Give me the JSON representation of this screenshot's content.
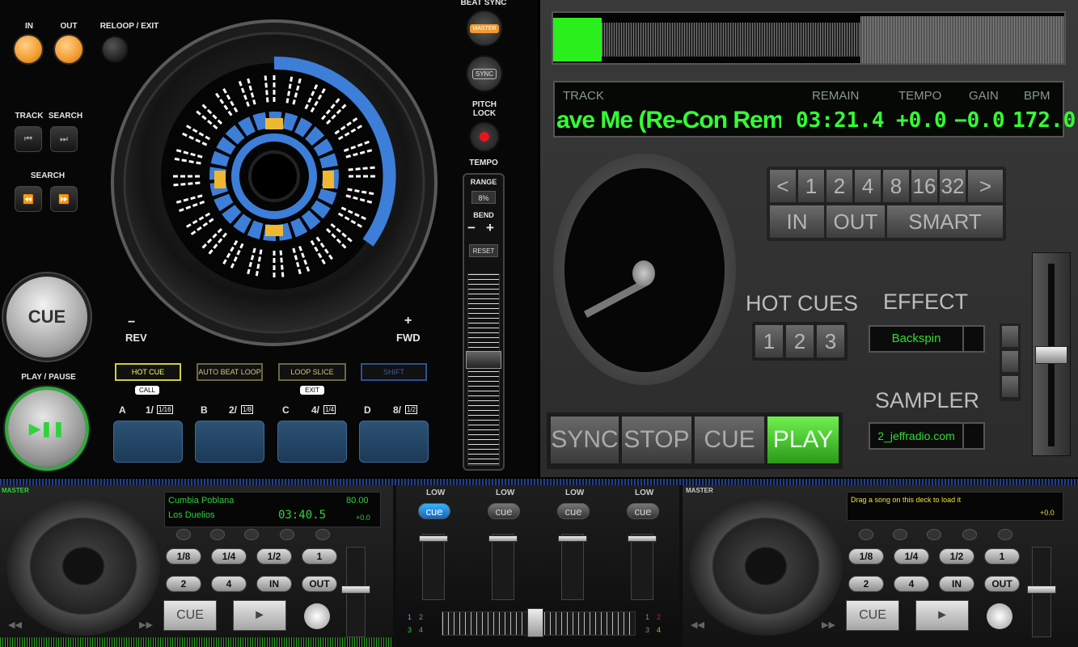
{
  "deck_a": {
    "in": "IN",
    "out": "OUT",
    "reloop": "RELOOP / EXIT",
    "track": "TRACK",
    "search_top": "SEARCH",
    "search": "SEARCH",
    "cue": "CUE",
    "play_pause": "PLAY / PAUSE",
    "rev_sign": "−",
    "rev": "REV",
    "fwd_sign": "+",
    "fwd": "FWD",
    "beat_sync": "BEAT SYNC",
    "master": "MASTER",
    "sync": "SYNC",
    "pitch_lock": "PITCH LOCK",
    "tempo": "TEMPO",
    "range": "RANGE",
    "range_value": "8%",
    "bend": "BEND",
    "bend_minus": "−",
    "bend_plus": "+",
    "reset": "RESET",
    "modes": [
      "HOT CUE",
      "AUTO BEAT LOOP",
      "LOOP SLICE",
      "SHIFT"
    ],
    "sub_call": "CALL",
    "sub_exit": "EXIT",
    "pads": [
      {
        "letter": "A",
        "value": "1/",
        "frac": "1/16"
      },
      {
        "letter": "B",
        "value": "2/",
        "frac": "1/8"
      },
      {
        "letter": "C",
        "value": "4/",
        "frac": "1/4"
      },
      {
        "letter": "D",
        "value": "8/",
        "frac": "1/2"
      }
    ]
  },
  "deck_b": {
    "lcd_labels": {
      "track": "TRACK",
      "remain": "REMAIN",
      "tempo": "TEMPO",
      "gain": "GAIN",
      "bpm": "BPM"
    },
    "lcd_values": {
      "track": "ave Me (Re-Con Rem",
      "remain": "03:21.4",
      "tempo": "+0.0",
      "gain": "−0.0",
      "bpm": "172.0"
    },
    "loop_buttons": [
      "<",
      "1",
      "2",
      "4",
      "8",
      "16",
      "32",
      ">"
    ],
    "in": "IN",
    "out": "OUT",
    "smart": "SMART",
    "hot_cues": "HOT CUES",
    "hot_cue_buttons": [
      "1",
      "2",
      "3"
    ],
    "effect": "EFFECT",
    "effect_value": "Backspin",
    "sampler": "SAMPLER",
    "sampler_value": "2_jeffradio.com",
    "transport": [
      "SYNC",
      "STOP",
      "CUE",
      "PLAY"
    ]
  },
  "mini_a": {
    "master": "MASTER",
    "title": "Cumbia Poblana",
    "bpm": "80.00",
    "artist": "Los Duelios",
    "time": "03:40.5",
    "pitch": "+0.0",
    "buttons_row1": [
      "1/8",
      "1/4",
      "1/2",
      "1"
    ],
    "buttons_row2": [
      "2",
      "4",
      "IN",
      "OUT"
    ],
    "cue": "CUE",
    "play": "►"
  },
  "mini_b": {
    "master": "MASTER",
    "message": "Drag a song on this deck to load it",
    "pitch": "+0.0",
    "buttons_row1": [
      "1/8",
      "1/4",
      "1/2",
      "1"
    ],
    "buttons_row2": [
      "2",
      "4",
      "IN",
      "OUT"
    ],
    "cue": "CUE",
    "play": "►"
  },
  "mixer": {
    "channels": [
      {
        "low": "LOW",
        "cue": "cue"
      },
      {
        "low": "LOW",
        "cue": "cue"
      },
      {
        "low": "LOW",
        "cue": "cue"
      },
      {
        "low": "LOW",
        "cue": "cue"
      }
    ],
    "left_nums": [
      "1",
      "2",
      "3",
      "4"
    ],
    "right_nums": [
      "1",
      "2",
      "3",
      "4"
    ]
  }
}
